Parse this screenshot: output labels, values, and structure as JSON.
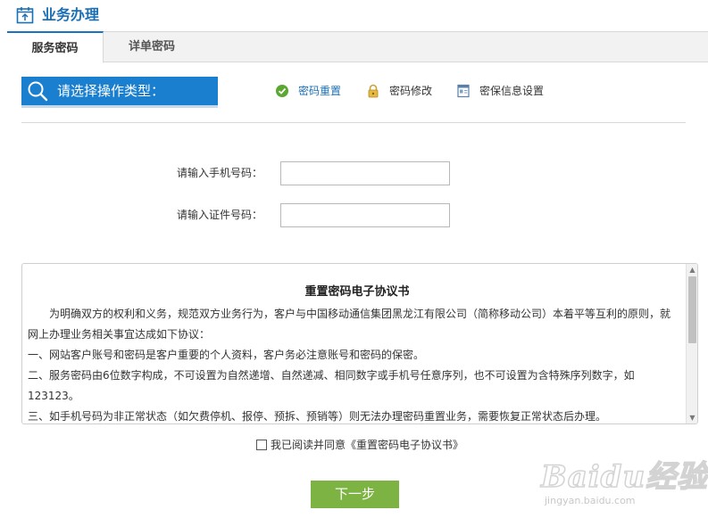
{
  "header": {
    "title": "业务办理"
  },
  "tabs": [
    {
      "label": "服务密码",
      "active": true
    },
    {
      "label": "详单密码",
      "active": false
    }
  ],
  "operation": {
    "prompt": "请选择操作类型：",
    "options": [
      {
        "label": "密码重置",
        "icon": "check-circle-icon",
        "selected": true
      },
      {
        "label": "密码修改",
        "icon": "lock-icon",
        "selected": false
      },
      {
        "label": "密保信息设置",
        "icon": "id-card-icon",
        "selected": false
      }
    ]
  },
  "form": {
    "phone_label": "请输入手机号码：",
    "phone_value": "",
    "id_label": "请输入证件号码：",
    "id_value": ""
  },
  "agreement": {
    "title": "重置密码电子协议书",
    "lines": [
      "　　为明确双方的权利和义务，规范双方业务行为，客户与中国移动通信集团黑龙江有限公司（简称移动公司）本着平等互利的原则，就",
      "网上办理业务相关事宜达成如下协议：",
      "一、网站客户账号和密码是客户重要的个人资料，客户务必注意账号和密码的保密。",
      "二、服务密码由6位数字构成，不可设置为自然递增、自然递减、相同数字或手机号任意序列，也不可设置为含特殊序列数字，如",
      "123123。",
      "三、如手机号码为非正常状态（如欠费停机、报停、预拆、预销等）则无法办理密码重置业务，需要恢复正常状态后办理。"
    ]
  },
  "consent": {
    "label": "我已阅读并同意《重置密码电子协议书》",
    "checked": false
  },
  "next_button": {
    "label": "下一步"
  },
  "watermark": {
    "brand": "Baidu经验",
    "url": "jingyan.baidu.com"
  },
  "colors": {
    "accent": "#1a7fcf",
    "title": "#1a6fb5",
    "button": "#7cb342"
  }
}
